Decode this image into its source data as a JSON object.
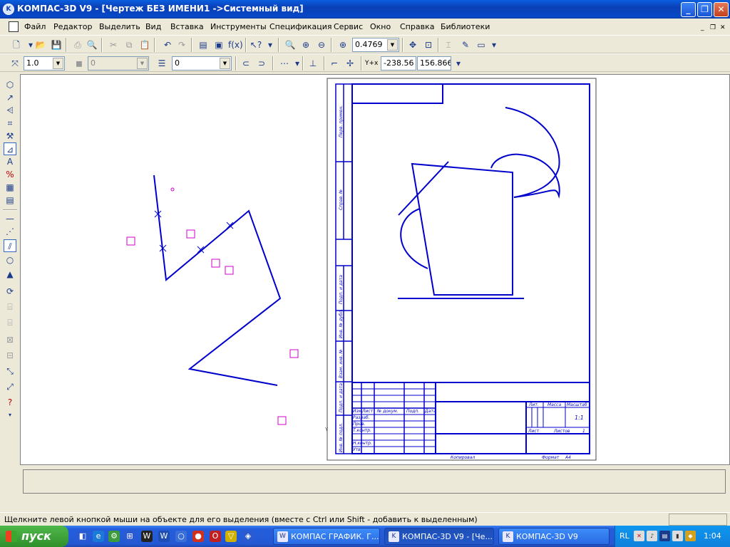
{
  "window": {
    "title": "КОМПАС-3D V9 - [Чертеж БЕЗ ИМЕНИ1 ->Системный вид]",
    "minimize": "_",
    "maximize": "❐",
    "close": "✕"
  },
  "menu": {
    "items": [
      "Файл",
      "Редактор",
      "Выделить",
      "Вид",
      "Вставка",
      "Инструменты",
      "Спецификация",
      "Сервис",
      "Окно",
      "Справка",
      "Библиотеки"
    ]
  },
  "toolbar1": {
    "zoom_value": "0.4769"
  },
  "toolbar2": {
    "scale_value": "1.0",
    "style_value": "0",
    "layer_value": "0",
    "coord_label": "Y+x",
    "coord_x": "-238.56",
    "coord_y": "156.866"
  },
  "drawing": {
    "sheet_labels": {
      "perv_primen": "Перв. примен.",
      "sprav_no": "Справ. №",
      "podp_data_1": "Подп. и дата",
      "inv_dubl": "Инв. № дубл.",
      "vzam_inv": "Взам. инв. №",
      "podp_data_2": "Подп. и дата",
      "inv_podl": "Инв. № подл."
    },
    "title_block": {
      "izm": "Изм.",
      "list": "Лист",
      "no_dokum": "№ докум.",
      "podp": "Подп.",
      "data": "Дата",
      "razrab": "Разраб.",
      "prov": "Пров.",
      "tkontr": "Т.контр.",
      "nkontr": "Н.контр.",
      "utv": "Утв.",
      "lit": "Лит.",
      "massa": "Масса",
      "masshtab": "Масштаб",
      "scale_value": "1:1",
      "list2": "Лист",
      "listov": "Листов",
      "listov_value": "1",
      "kopiroval": "Копировал",
      "format": "Формат",
      "format_value": "A4"
    }
  },
  "status": {
    "message": "Щелкните левой кнопкой мыши на объекте для его выделения (вместе с Ctrl или Shift - добавить к выделенным)"
  },
  "taskbar": {
    "start_label": "пуск",
    "tasks": [
      {
        "label": "КОМПАС ГРАФИК. Г...",
        "active": false
      },
      {
        "label": "КОМПАС-3D V9 - [Че...",
        "active": true
      },
      {
        "label": "КОМПАС-3D V9",
        "active": false
      }
    ],
    "lang": "RL",
    "clock": "1:04"
  },
  "colors": {
    "drawing_line": "#0000cc",
    "selection_marker": "#d000d0",
    "title_bar": "#0a3fb5",
    "taskbar": "#245edc"
  }
}
